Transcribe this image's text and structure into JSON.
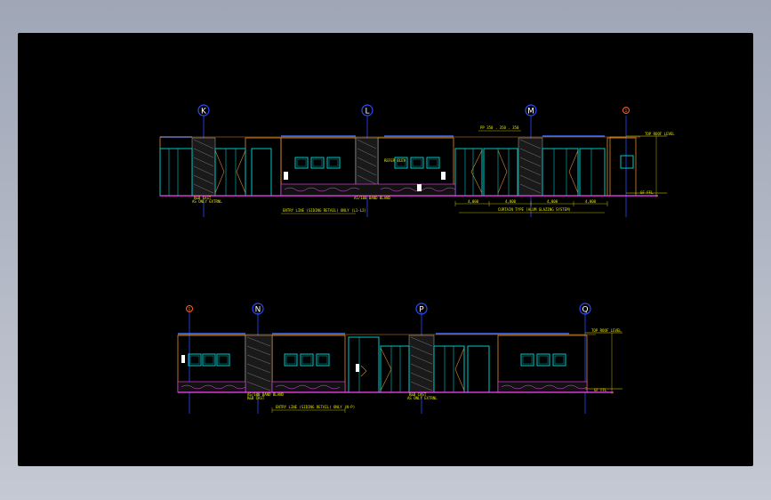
{
  "drawing": {
    "elevation_top": {
      "grid_labels": [
        "K",
        "L",
        "M",
        "1"
      ],
      "level_top": "TOP ROOF LEVEL",
      "level_bottom": "GF FFL",
      "notes": [
        "R&B CAST",
        "AS ONLY EXTRNL",
        "AS/100 BAND BLAND",
        "REFER ELEV"
      ],
      "dims": [
        "4,000",
        "4,000",
        "4,000",
        "4,000"
      ],
      "dim_callouts": [
        "ENTRY LINE (SIDING RETAIL) ONLY (L1-L2)",
        "CURTAIN TYPE (ALUM GLAZING SYSTEM)"
      ],
      "top_dims": "PP 350 . 350 . 350"
    },
    "elevation_bottom": {
      "grid_labels": [
        "1",
        "N",
        "P",
        "Q"
      ],
      "level_top": "TOP ROOF LEVEL",
      "level_bottom": "GF FFL",
      "notes": [
        "AS/100 BAND BLAND",
        "R&B CAST",
        "AS ONLY EXTRNL"
      ],
      "dim_callouts": [
        "ENTRY LINE (SIDING RETAIL) ONLY (N-P)"
      ]
    },
    "colors": {
      "background": "#000000",
      "frame": "#9fa6b6",
      "wall": "#e08a2a",
      "roof": "#3a6cff",
      "glass": "#00c8c8",
      "hatch": "#d8d8d8",
      "base": "#ff40ff",
      "text": "#e6e600",
      "grid": "#2a4cff"
    }
  }
}
